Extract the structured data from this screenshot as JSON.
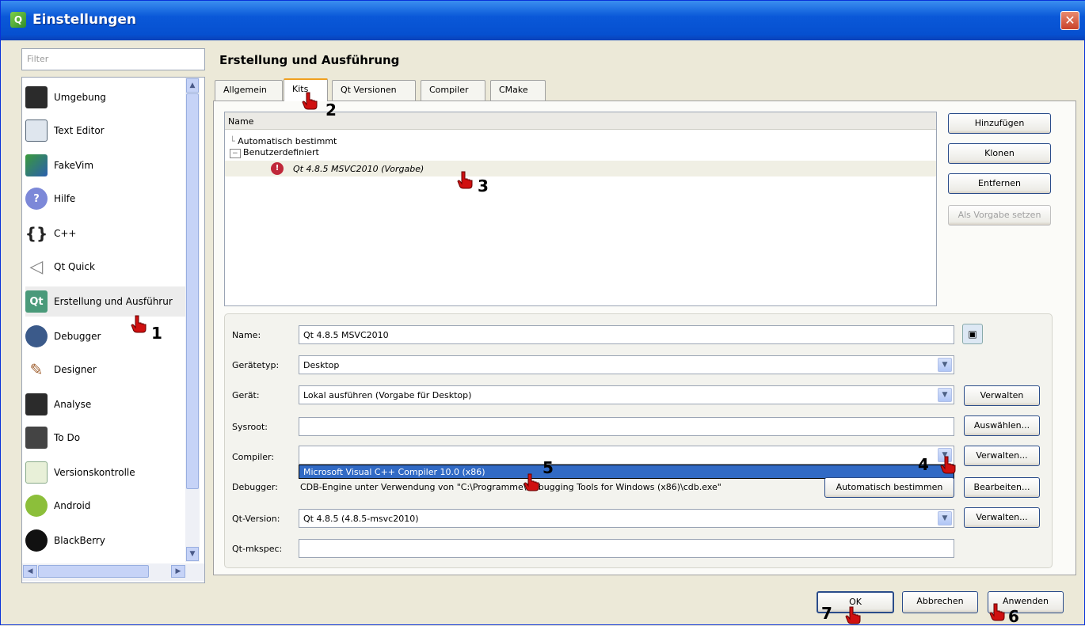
{
  "window": {
    "title": "Einstellungen",
    "close": "✕"
  },
  "filter": {
    "placeholder": "Filter"
  },
  "categories": [
    {
      "label": "Umgebung",
      "icon": "monitor-icon"
    },
    {
      "label": "Text Editor",
      "icon": "text-editor-icon"
    },
    {
      "label": "FakeVim",
      "icon": "fakevim-icon"
    },
    {
      "label": "Hilfe",
      "icon": "help-icon"
    },
    {
      "label": "C++",
      "icon": "cpp-braces-icon"
    },
    {
      "label": "Qt Quick",
      "icon": "qt-quick-icon"
    },
    {
      "label": "Erstellung und Ausführur",
      "icon": "build-run-icon"
    },
    {
      "label": "Debugger",
      "icon": "debugger-icon"
    },
    {
      "label": "Designer",
      "icon": "designer-icon"
    },
    {
      "label": "Analyse",
      "icon": "analyze-icon"
    },
    {
      "label": "To Do",
      "icon": "todo-icon"
    },
    {
      "label": "Versionskontrolle",
      "icon": "version-control-icon"
    },
    {
      "label": "Android",
      "icon": "android-icon"
    },
    {
      "label": "BlackBerry",
      "icon": "blackberry-icon"
    }
  ],
  "page_title": "Erstellung und Ausführung",
  "tabs": [
    "Allgemein",
    "Kits",
    "Qt Versionen",
    "Compiler",
    "CMake"
  ],
  "tree": {
    "header": "Name",
    "auto": "Automatisch bestimmt",
    "user": "Benutzerdefiniert",
    "kit": "Qt 4.8.5 MSVC2010 (Vorgabe)"
  },
  "side_buttons": {
    "add": "Hinzufügen",
    "clone": "Klonen",
    "remove": "Entfernen",
    "default": "Als Vorgabe setzen"
  },
  "form": {
    "name_label": "Name:",
    "name_value": "Qt 4.8.5 MSVC2010",
    "devtype_label": "Gerätetyp:",
    "devtype_value": "Desktop",
    "device_label": "Gerät:",
    "device_value": "Lokal ausführen (Vorgabe für Desktop)",
    "sysroot_label": "Sysroot:",
    "sysroot_value": "",
    "compiler_label": "Compiler:",
    "compiler_value": "",
    "compiler_option": "Microsoft Visual C++ Compiler 10.0 (x86)",
    "debugger_label": "Debugger:",
    "debugger_value": "CDB-Engine unter Verwendung von \"C:\\Programme\\Debugging Tools for Windows (x86)\\cdb.exe\"",
    "qtversion_label": "Qt-Version:",
    "qtversion_value": "Qt 4.8.5 (4.8.5-msvc2010)",
    "mkspec_label": "Qt-mkspec:",
    "mkspec_value": ""
  },
  "form_buttons": {
    "manage1": "Verwalten",
    "choose": "Auswählen...",
    "manage2": "Verwalten...",
    "auto_detect": "Automatisch bestimmen",
    "edit": "Bearbeiten...",
    "manage3": "Verwalten..."
  },
  "bottom_buttons": {
    "ok": "OK",
    "cancel": "Abbrechen",
    "apply": "Anwenden"
  },
  "annotations": [
    "1",
    "2",
    "3",
    "4",
    "5",
    "6",
    "7"
  ],
  "colors": {
    "title_bar": "#0a58d8",
    "selection": "#316ac5",
    "tab_highlight": "#f0a020",
    "hand": "#d01010"
  }
}
